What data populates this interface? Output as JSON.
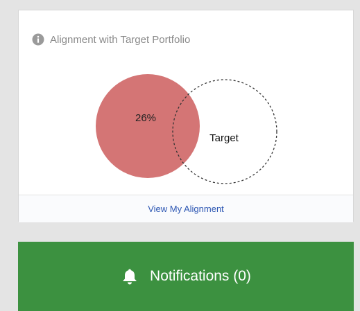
{
  "alignment_card": {
    "title": "Alignment with Target Portfolio",
    "title_icon": "info-icon",
    "overlap_percent": 26,
    "overlap_label": "26%",
    "target_label": "Target",
    "footer_link": "View My Alignment",
    "colors": {
      "portfolio_fill": "#d47575",
      "target_stroke": "#333333",
      "link": "#2d57b3"
    }
  },
  "notifications": {
    "label": "Notifications (0)",
    "icon": "bell-icon",
    "color": "#3c9140"
  }
}
